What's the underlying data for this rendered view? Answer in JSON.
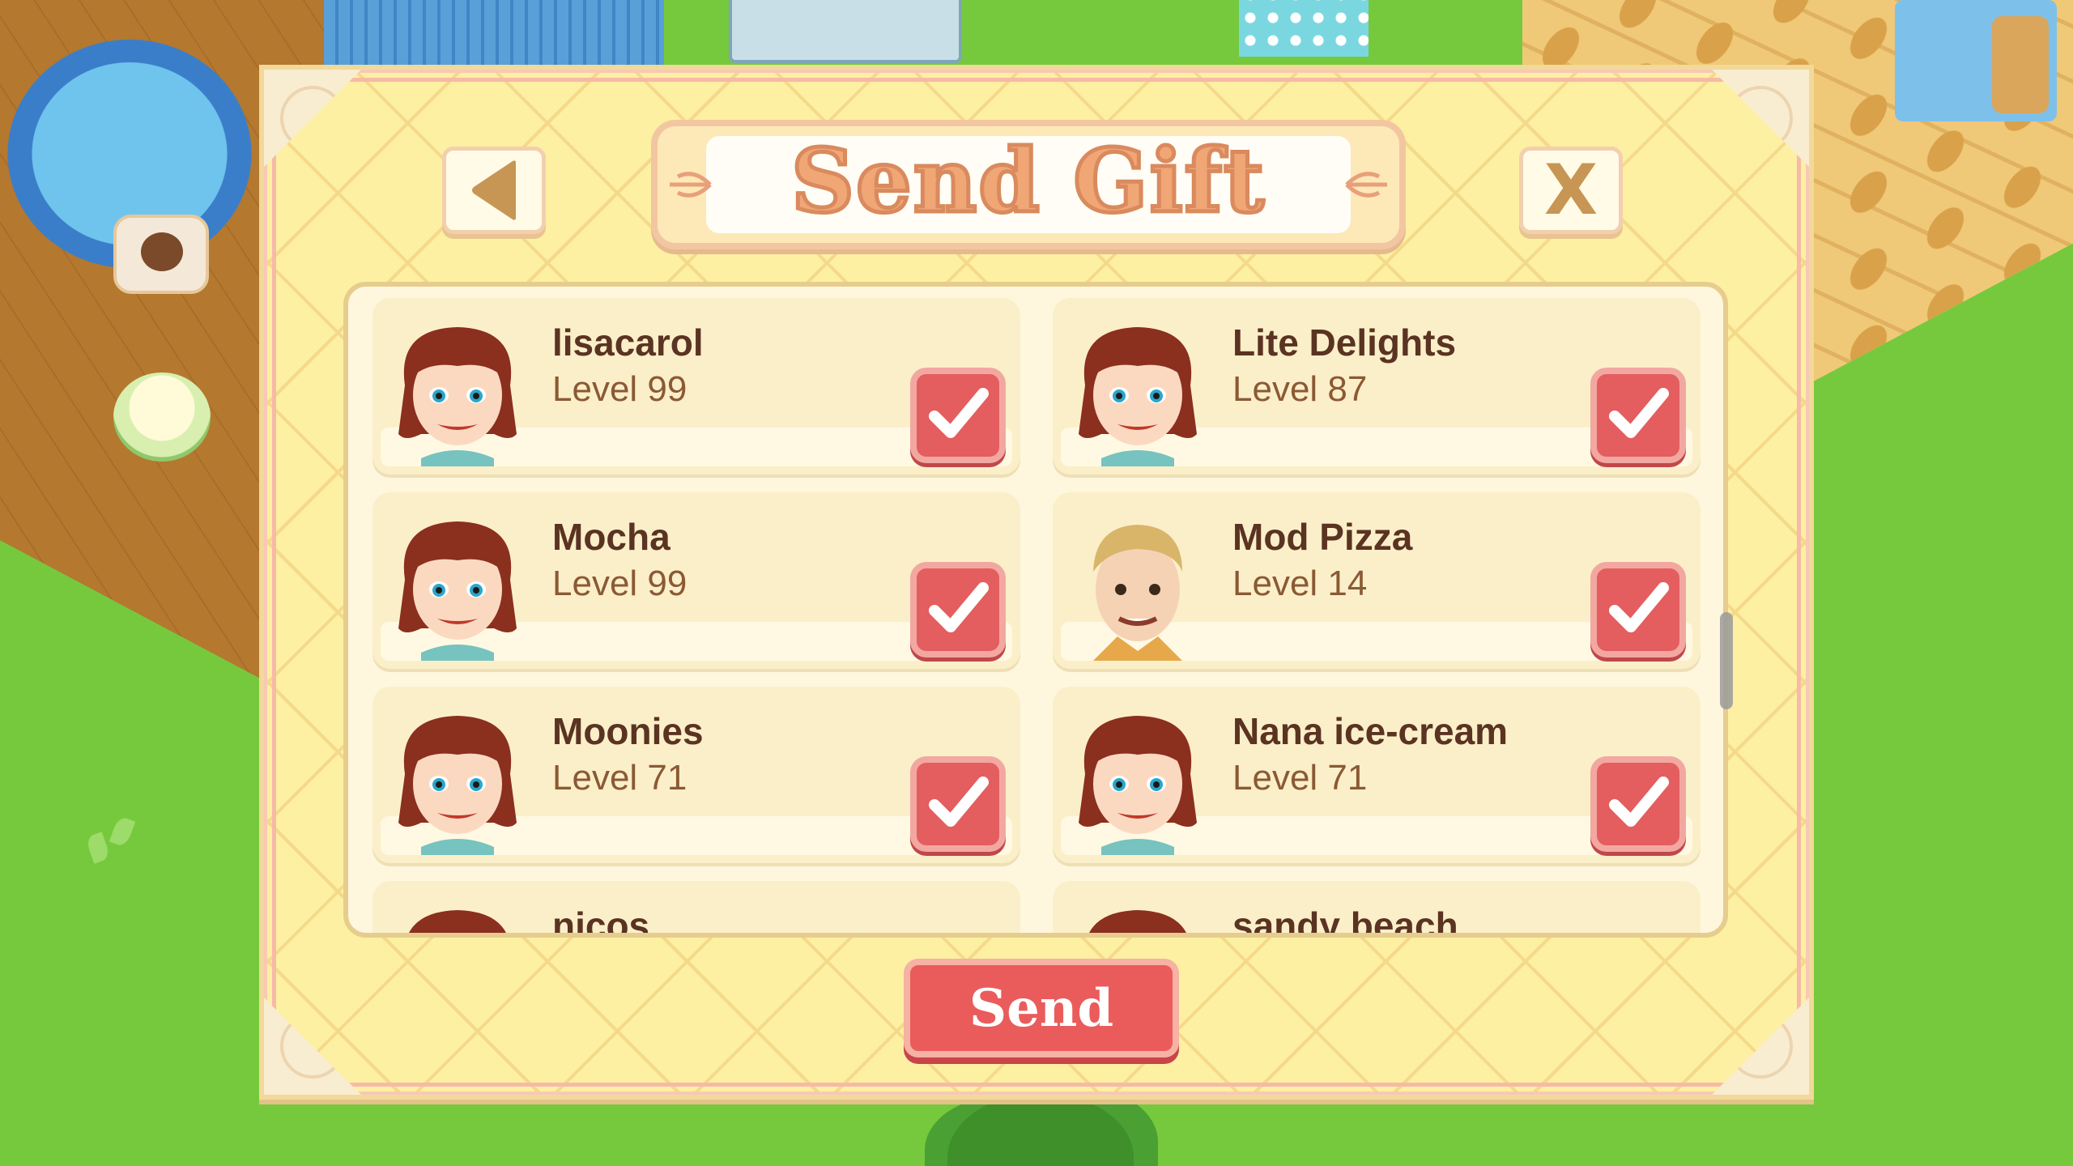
{
  "dialog": {
    "title": "Send Gift",
    "close_label": "X",
    "send_label": "Send"
  },
  "friends": [
    {
      "name": "lisacarol",
      "level": "Level 99",
      "avatar": "female-chef",
      "checked": true
    },
    {
      "name": "Lite Delights",
      "level": "Level 87",
      "avatar": "female-chef",
      "checked": true
    },
    {
      "name": "Mocha",
      "level": "Level 99",
      "avatar": "female-chef",
      "checked": true
    },
    {
      "name": "Mod Pizza",
      "level": "Level 14",
      "avatar": "male-chef",
      "checked": true
    },
    {
      "name": "Moonies",
      "level": "Level 71",
      "avatar": "female-chef",
      "checked": true
    },
    {
      "name": "Nana ice-cream",
      "level": "Level 71",
      "avatar": "female-chef",
      "checked": true
    },
    {
      "name": "nicos",
      "level": "",
      "avatar": "female-chef",
      "checked": false
    },
    {
      "name": "sandy beach",
      "level": "",
      "avatar": "female-chef",
      "checked": false
    }
  ],
  "icons": {
    "back": "triangle-left-icon",
    "close": "x-icon",
    "check": "checkmark-icon"
  },
  "colors": {
    "panel": "#fdf0a2",
    "checkbox": "#e45d5f",
    "send_button": "#ea5c5c",
    "title_text": "#f0a675"
  }
}
